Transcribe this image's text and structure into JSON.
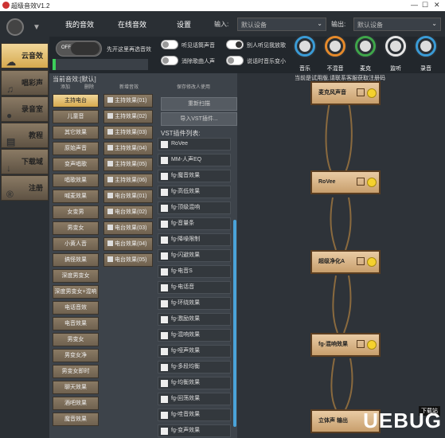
{
  "app": {
    "title": "超级音效V1.2"
  },
  "sidebar": {
    "items": [
      {
        "label": "云音效",
        "active": true,
        "icon": "cloud-icon"
      },
      {
        "label": "唱彩声",
        "icon": "music-icon"
      },
      {
        "label": "录音室",
        "icon": "mic-icon"
      },
      {
        "label": "教程",
        "icon": "book-icon"
      },
      {
        "label": "下载域",
        "icon": "download-icon"
      },
      {
        "label": "注册",
        "icon": "register-icon"
      }
    ]
  },
  "topbar": {
    "tabs": [
      "我的音效",
      "在线音效",
      "设置"
    ],
    "input_label": "输入:",
    "input_value": "默认设备",
    "output_label": "输出:",
    "output_value": "默认设备"
  },
  "controls": {
    "master_toggle": "OFF",
    "master_hint": "先开这里再选音效",
    "toggles": [
      {
        "label": "听见话筒声音",
        "on": false
      },
      {
        "label": "别人听见我放歌",
        "on": true
      },
      {
        "label": "消除歌曲人声",
        "on": false
      },
      {
        "label": "说话时音乐变小",
        "on": false
      }
    ],
    "dials": [
      {
        "label": "音乐",
        "color": "#3a9bd6"
      },
      {
        "label": "不混音",
        "color": "#e58a2b"
      },
      {
        "label": "麦克",
        "color": "#3fa64a"
      },
      {
        "label": "监听",
        "color": "#e5e5e5"
      },
      {
        "label": "录音",
        "color": "#3a9bd6"
      }
    ]
  },
  "panel": {
    "current": "当前音效:[默认]",
    "col_headers": [
      "添加",
      "删除",
      "新增音效",
      "保存修改人使用"
    ],
    "presets": [
      "主持电台",
      "儿童音",
      "其它效果",
      "原始声音",
      "变声唱歌",
      "唱歌效果",
      "喊麦效果",
      "女变男",
      "男变女",
      "小黄人音",
      "搞怪效果",
      "深度男变女",
      "深度男变女+混响",
      "电话音效",
      "电音效果",
      "男变女",
      "男变女净",
      "男变女即时",
      "聊天效果",
      "酒吧效果",
      "魔音效果"
    ],
    "effects": [
      "主持效果(01)",
      "主持效果(02)",
      "主持效果(03)",
      "主持效果(04)",
      "主持效果(05)",
      "主持效果(06)",
      "电台效果(01)",
      "电台效果(02)",
      "电台效果(03)",
      "电台效果(04)",
      "电台效果(05)"
    ],
    "actions": [
      "重新扫描",
      "导入VST插件..."
    ],
    "vst_title": "VST插件列表:",
    "vst": [
      "RoVee",
      "MM-人声EQ",
      "fg-魔音效果",
      "fg-高低效果",
      "fg-顶级混响",
      "fg-音量条",
      "fg-降噪限制",
      "fg-闪避效果",
      "fg-电音S",
      "fg-电话音",
      "fg-环绕效果",
      "fg-激励效果",
      "fg-混响效果",
      "fg-哑声效果",
      "fg-多段均衡",
      "fg-均衡效果",
      "fg-回荡效果",
      "fg-哇音效果",
      "fg-变声效果"
    ]
  },
  "canvas": {
    "notice": "当前是试用版,请联系客服获取注册码",
    "nodes": [
      "麦克风声音",
      "RoVee",
      "超级净化A",
      "fg-混响效果",
      "立体声 输出"
    ]
  },
  "watermark": {
    "text": "UEBUG",
    "sub": "下载站"
  }
}
